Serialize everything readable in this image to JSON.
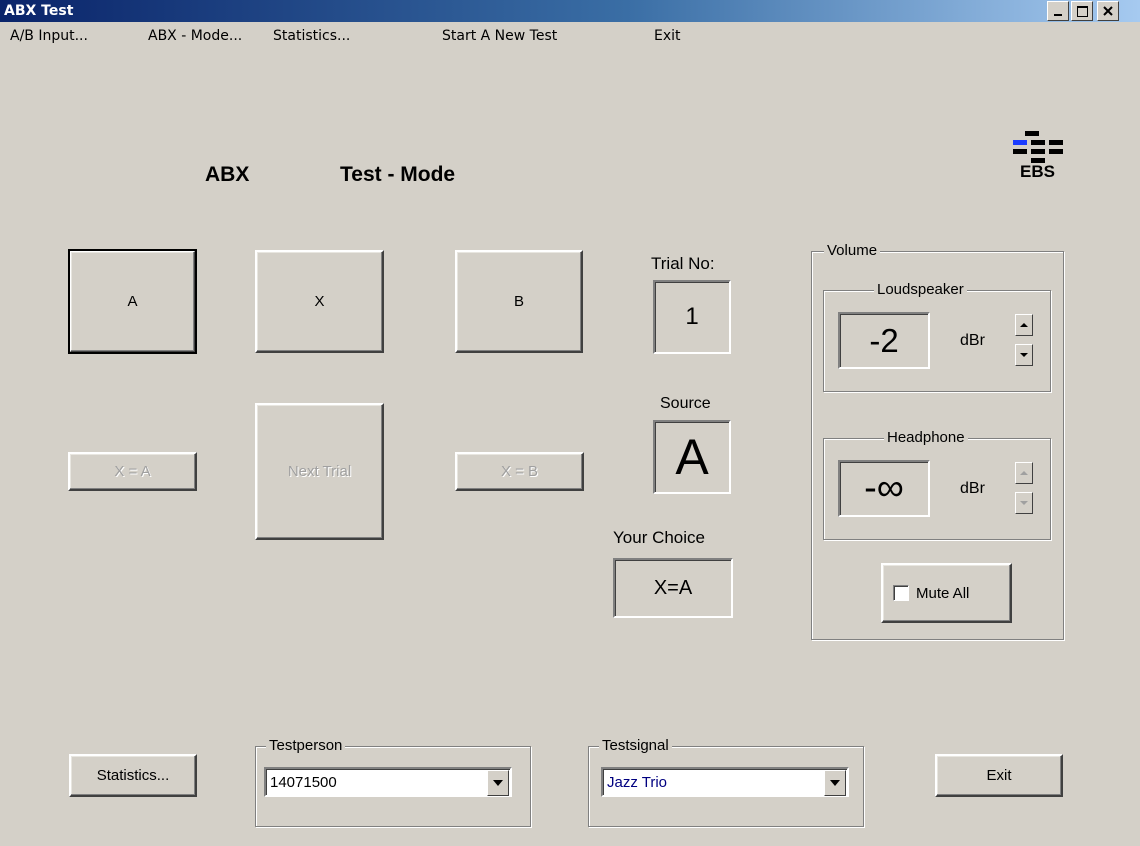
{
  "window": {
    "title": "ABX Test"
  },
  "menu": {
    "ab_input": "A/B Input...",
    "abx_mode": "ABX - Mode...",
    "statistics": "Statistics...",
    "new_test": "Start A New Test",
    "exit": "Exit"
  },
  "heading": {
    "abx": "ABX",
    "test_mode": "Test - Mode"
  },
  "logo": {
    "text": "EBS"
  },
  "buttons": {
    "a": "A",
    "x": "X",
    "b": "B",
    "x_eq_a": "X = A",
    "next_trial": "Next Trial",
    "x_eq_b": "X = B",
    "statistics": "Statistics...",
    "exit": "Exit"
  },
  "status": {
    "trial_label": "Trial No:",
    "trial_value": "1",
    "source_label": "Source",
    "source_value": "A",
    "choice_label": "Your Choice",
    "choice_value": "X=A"
  },
  "volume": {
    "group_label": "Volume",
    "loudspeaker": {
      "label": "Loudspeaker",
      "value": "-2",
      "unit": "dBr"
    },
    "headphone": {
      "label": "Headphone",
      "value": "-∞",
      "unit": "dBr"
    },
    "mute_label": "Mute All",
    "mute_checked": false
  },
  "testperson": {
    "label": "Testperson",
    "value": "14071500"
  },
  "testsignal": {
    "label": "Testsignal",
    "value": "Jazz Trio"
  },
  "colors": {
    "titlebar_start": "#0a246a",
    "titlebar_end": "#a6caf0",
    "face": "#d4d0c8",
    "signal_text": "#000080"
  }
}
